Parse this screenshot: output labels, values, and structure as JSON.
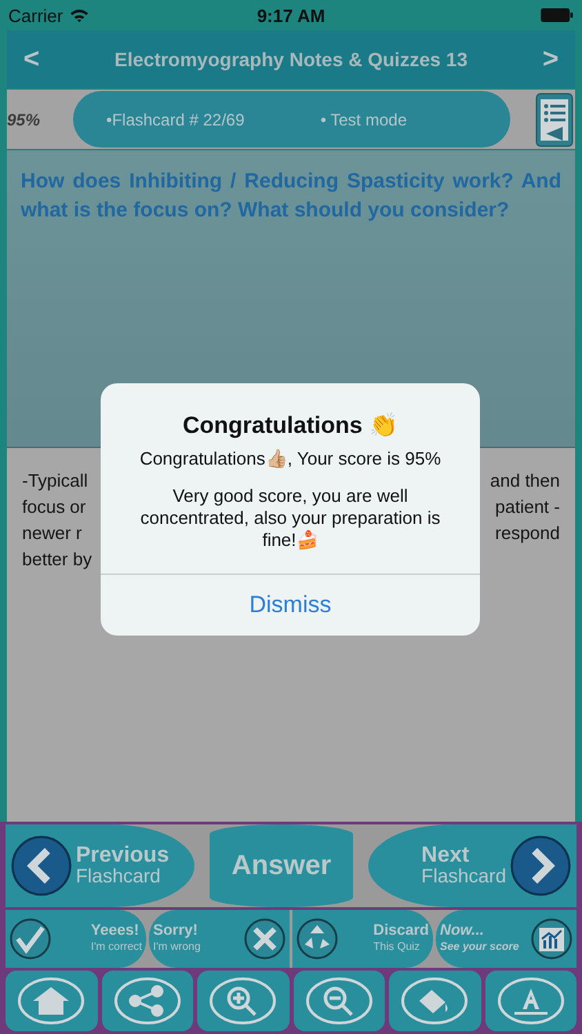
{
  "status_bar": {
    "carrier": "Carrier",
    "time": "9:17 AM"
  },
  "nav": {
    "back": "<",
    "title": "Electromyography Notes & Quizzes 13",
    "forward": ">"
  },
  "progress": {
    "score": "95%",
    "flashcard": "•Flashcard #  22/69",
    "mode": "• Test mode"
  },
  "question": "How does Inhibiting / Reducing Spasticity work? And what is the focus on? What should you consider?",
  "answer_lines": [
    {
      "left": "-Typicall",
      "right": "and then"
    },
    {
      "left": "focus or",
      "right": "patient -"
    },
    {
      "left": "newer r",
      "right": "respond"
    },
    {
      "left": "better by"
    }
  ],
  "dialog": {
    "title": "Congratulations 👏",
    "message": "Congratulations👍🏼, Your score is 95%",
    "body": "Very good score, you are well concentrated, also your preparation is fine!🍰",
    "button": "Dismiss"
  },
  "nav_buttons": [
    {
      "kind": "previous",
      "title": "Previous",
      "subtitle": "Flashcard"
    },
    {
      "kind": "answer",
      "title": "Answer"
    },
    {
      "kind": "next",
      "title": "Next",
      "subtitle": "Flashcard"
    }
  ],
  "mark_buttons": [
    {
      "kind": "correct",
      "title": "Yeees!",
      "subtitle": "I'm correct"
    },
    {
      "kind": "wrong",
      "title": "Sorry!",
      "subtitle": "I'm wrong"
    },
    {
      "kind": "discard",
      "title": "Discard",
      "subtitle": "This Quiz"
    },
    {
      "kind": "score",
      "title": "Now...",
      "subtitle": "See your score"
    }
  ],
  "tools": [
    {
      "kind": "home"
    },
    {
      "kind": "share"
    },
    {
      "kind": "zoom-in"
    },
    {
      "kind": "zoom-out"
    },
    {
      "kind": "fill"
    },
    {
      "kind": "font"
    }
  ]
}
